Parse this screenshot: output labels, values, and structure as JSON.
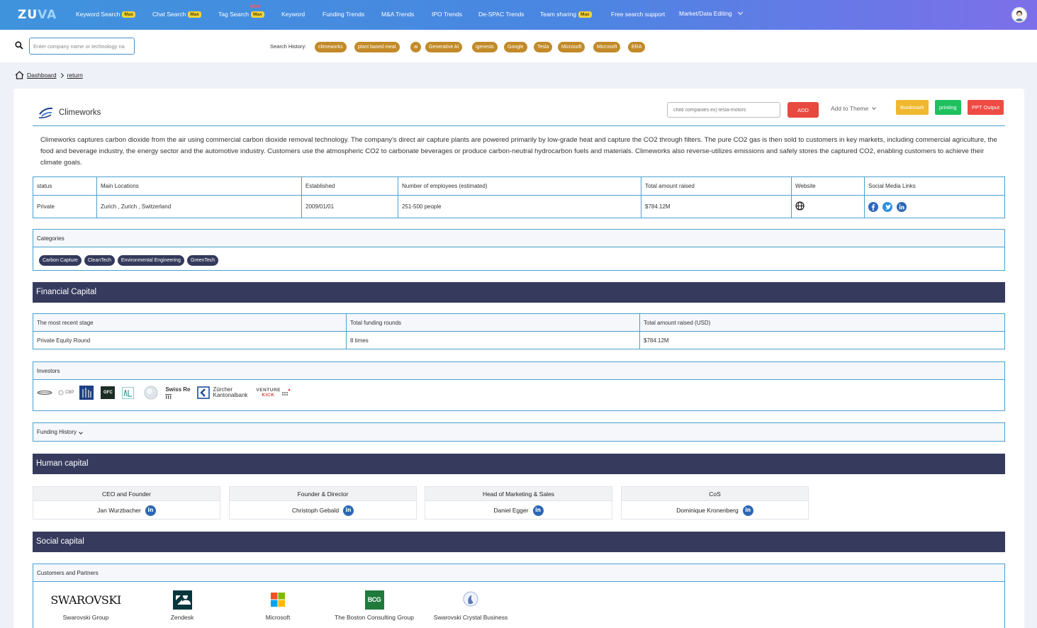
{
  "nav": {
    "logo_a": "ZU",
    "logo_b": "VA",
    "max_label": "Max",
    "new_label": "NEW",
    "items": [
      {
        "label": "Keyword Search",
        "max": true
      },
      {
        "label": "Chat Search",
        "max": true
      },
      {
        "label": "Tag Search",
        "max": true,
        "new": true
      },
      {
        "label": "Keyword"
      },
      {
        "label": "Funding Trends"
      },
      {
        "label": "M&A Trends"
      },
      {
        "label": "IPO Trends"
      },
      {
        "label": "De-SPAC Trends"
      },
      {
        "label": "Team sharing",
        "max": true
      },
      {
        "label": "Free search support"
      },
      {
        "label": "Market/Data Editing",
        "dropdown": true
      }
    ]
  },
  "search": {
    "placeholder": "Enter company name or technology na",
    "history_label": "Search History:",
    "history": [
      "climeworks",
      "plant based meat",
      "ai",
      "Generative AI",
      "igenesis",
      "Google",
      "Tesla",
      "Microsoft",
      "Microsoft",
      "ERA"
    ]
  },
  "breadcrumb": {
    "home": "Dashboard",
    "back": "return"
  },
  "company": {
    "name": "Climeworks",
    "child_placeholder": "child companies ex) tesla-motors",
    "add_label": "ADD",
    "theme_label": "Add to Theme",
    "bookmark_label": "Bookmark",
    "print_label": "printing",
    "ppt_label": "PPT Output",
    "description": "Climeworks captures carbon dioxide from the air using commercial carbon dioxide removal technology. The company's direct air capture plants are powered primarily by low-grade heat and capture the CO2 through filters. The pure CO2 gas is then sold to customers in key markets, including commercial agriculture, the food and beverage industry, the energy sector and the automotive industry. Customers use the atmospheric CO2 to carbonate beverages or produce carbon-neutral hydrocarbon fuels and materials. Climeworks also reverse-utilizes emissions and safely stores the captured CO2, enabling customers to achieve their climate goals."
  },
  "info": {
    "headers": [
      "status",
      "Main Locations",
      "Established",
      "Number of employees (estimated)",
      "Total amount raised",
      "Website",
      "Social Media Links"
    ],
    "values": [
      "Private",
      "Zurich , Zurich , Switzerland",
      "2009/01/01",
      "251-500 people",
      "$784.12M"
    ]
  },
  "categories": {
    "title": "Categories",
    "items": [
      "Carbon Capture",
      "CleanTech",
      "Environmental Engineering",
      "GreenTech"
    ]
  },
  "sections": {
    "financial": "Financial Capital",
    "human": "Human capital",
    "social": "Social capital"
  },
  "financial": {
    "headers": [
      "The most recent stage",
      "Total funding rounds",
      "Total amount raised (USD)"
    ],
    "values": [
      "Private Equity Round",
      "8 times",
      "$784.12M"
    ]
  },
  "investors": {
    "title": "Investors",
    "logo_texts": {
      "gfc": "GFC",
      "swissre": "Swiss Re",
      "zkb1": "Zürcher",
      "zkb2": "Kantonalbank",
      "vk1": "VENTURE",
      "vk2": "KICK",
      "cbp": "CBP"
    }
  },
  "funding_history": {
    "title": "Funding History"
  },
  "people": [
    {
      "role": "CEO and Founder",
      "name": "Jan Wurzbacher"
    },
    {
      "role": "Founder & Director",
      "name": "Christoph Gebald"
    },
    {
      "role": "Head of Marketing & Sales",
      "name": "Daniel Egger"
    },
    {
      "role": "CoS",
      "name": "Dominique Kronenberg"
    }
  ],
  "partners": {
    "title": "Customers and Partners",
    "swarovski_logo": "SWAROVSKI",
    "bcg_logo": "BCG",
    "items": [
      "Swarovski Group",
      "Zendesk",
      "Microsoft",
      "The Boston Consulting Group",
      "Swarovski Crystal Business"
    ]
  },
  "colors": {
    "accent": "#4aa0cf",
    "section": "#363b5e",
    "chip": "#c28a28",
    "add": "#e8493f",
    "bookmark": "#f0b82e",
    "print": "#1fc15f",
    "ppt": "#ee4b43"
  }
}
